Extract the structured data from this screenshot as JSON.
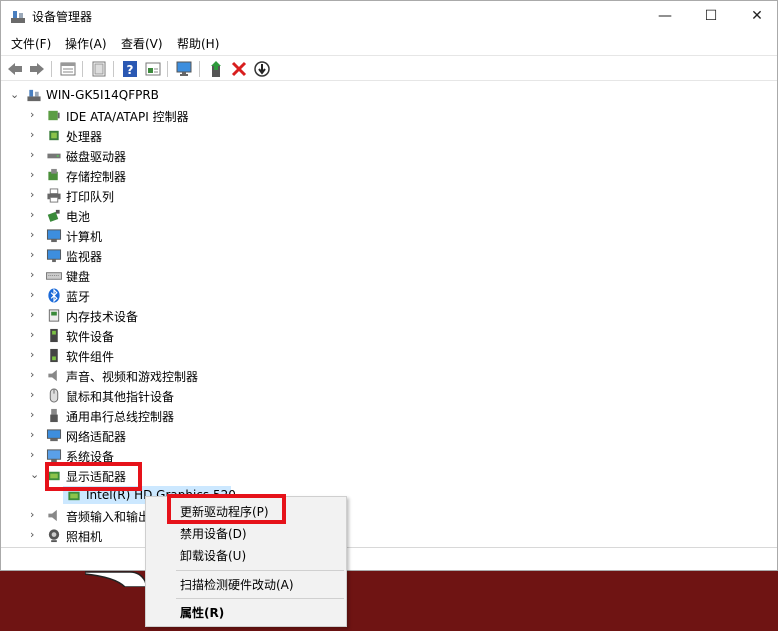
{
  "window": {
    "title": "设备管理器",
    "minimize": "—",
    "maximize": "☐",
    "close": "✕"
  },
  "menu": [
    "文件(F)",
    "操作(A)",
    "查看(V)",
    "帮助(H)"
  ],
  "toolbar": {
    "icons": [
      "back-icon",
      "forward-icon",
      "properties-icon",
      "show-hide-console-icon",
      "help-icon",
      "details-icon",
      "monitor-icon",
      "update-driver-icon",
      "uninstall-icon",
      "scan-icon"
    ]
  },
  "tree": {
    "root": "WIN-GK5I14QFPRB",
    "categories": [
      "IDE ATA/ATAPI 控制器",
      "处理器",
      "磁盘驱动器",
      "存储控制器",
      "打印队列",
      "电池",
      "计算机",
      "监视器",
      "键盘",
      "蓝牙",
      "内存技术设备",
      "软件设备",
      "软件组件",
      "声音、视频和游戏控制器",
      "鼠标和其他指针设备",
      "通用串行总线控制器",
      "网络适配器",
      "系统设备",
      "显示适配器",
      "音频输入和输出",
      "照相机"
    ],
    "expanded_child": "Intel(R) HD Graphics 520"
  },
  "context_menu": {
    "items": [
      "更新驱动程序(P)",
      "禁用设备(D)",
      "卸载设备(U)",
      "扫描检测硬件改动(A)",
      "属性(R)"
    ]
  },
  "colors": {
    "highlight_box": "#e6121a",
    "background": "#6f1413",
    "selection": "#cce8ff"
  }
}
